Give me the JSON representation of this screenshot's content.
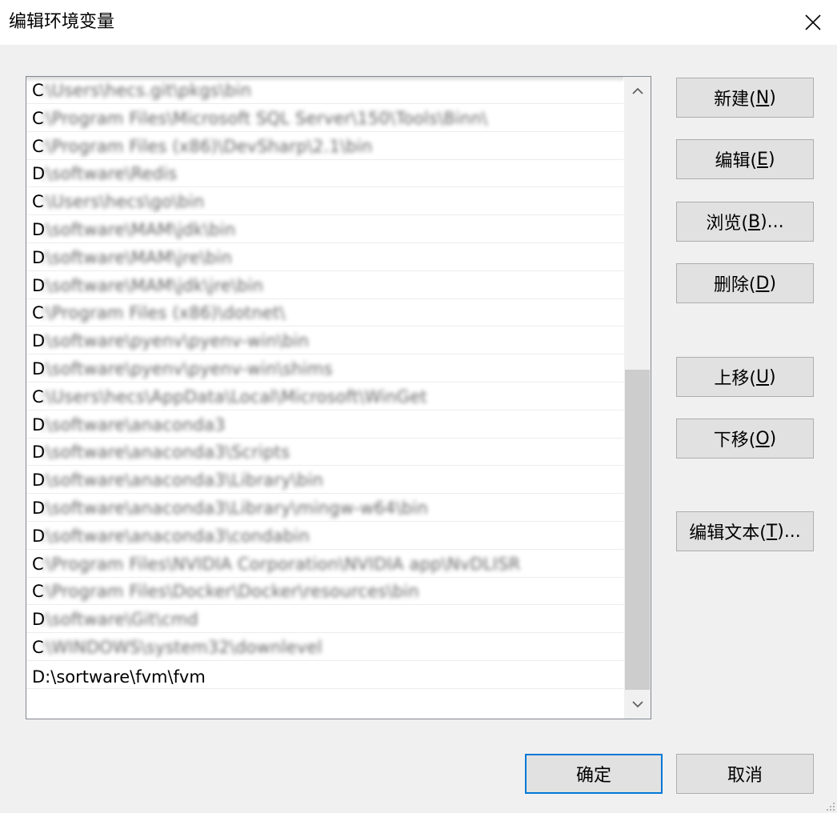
{
  "window": {
    "title": "编辑环境变量"
  },
  "icons": {
    "close": "close-icon",
    "scroll_up": "chevron-up-icon",
    "scroll_down": "chevron-down-icon",
    "size_grip": "size-grip-icon"
  },
  "path_list": {
    "items": [
      {
        "lead": "C",
        "text": ":\\Users\\hecs.git\\pkgs\\bin"
      },
      {
        "lead": "C",
        "text": ":\\Program Files\\Microsoft SQL Server\\150\\Tools\\Binn\\"
      },
      {
        "lead": "C",
        "text": ":\\Program Files (x86)\\DevSharp\\2.1\\bin"
      },
      {
        "lead": "D",
        "text": ":\\software\\Redis"
      },
      {
        "lead": "C",
        "text": ":\\Users\\hecs\\go\\bin"
      },
      {
        "lead": "D",
        "text": ":\\software\\MAM\\jdk\\bin"
      },
      {
        "lead": "D",
        "text": ":\\software\\MAM\\jre\\bin"
      },
      {
        "lead": "D",
        "text": ":\\software\\MAM\\jdk\\jre\\bin"
      },
      {
        "lead": "C",
        "text": ":\\Program Files (x86)\\dotnet\\"
      },
      {
        "lead": "D",
        "text": ":\\software\\pyenv\\pyenv-win\\bin"
      },
      {
        "lead": "D",
        "text": ":\\software\\pyenv\\pyenv-win\\shims"
      },
      {
        "lead": "C",
        "text": ":\\Users\\hecs\\AppData\\Local\\Microsoft\\WinGet"
      },
      {
        "lead": "D",
        "text": ":\\software\\anaconda3"
      },
      {
        "lead": "D",
        "text": ":\\software\\anaconda3\\Scripts"
      },
      {
        "lead": "D",
        "text": ":\\software\\anaconda3\\Library\\bin"
      },
      {
        "lead": "D",
        "text": ":\\software\\anaconda3\\Library\\mingw-w64\\bin"
      },
      {
        "lead": "D",
        "text": ":\\software\\anaconda3\\condabin"
      },
      {
        "lead": "C",
        "text": ":\\Program Files\\NVIDIA Corporation\\NVIDIA app\\NvDLISR"
      },
      {
        "lead": "C",
        "text": ":\\Program Files\\Docker\\Docker\\resources\\bin"
      },
      {
        "lead": "D",
        "text": ":\\software\\Git\\cmd"
      },
      {
        "lead": "C",
        "text": ":\\WINDOWS\\system32\\downlevel"
      }
    ],
    "selected_item": "D:\\sortware\\fvm\\fvm"
  },
  "buttons": {
    "new": {
      "label": "新建(",
      "key": "N",
      "suffix": ")"
    },
    "edit": {
      "label": "编辑(",
      "key": "E",
      "suffix": ")"
    },
    "browse": {
      "label": "浏览(",
      "key": "B",
      "suffix": ")..."
    },
    "delete": {
      "label": "删除(",
      "key": "D",
      "suffix": ")"
    },
    "move_up": {
      "label": "上移(",
      "key": "U",
      "suffix": ")"
    },
    "move_down": {
      "label": "下移(",
      "key": "O",
      "suffix": ")"
    },
    "edit_text": {
      "label": "编辑文本(",
      "key": "T",
      "suffix": ")..."
    },
    "ok": "确定",
    "cancel": "取消"
  },
  "colors": {
    "accent": "#0078d7",
    "dialog_bg": "#f0f0f0",
    "button_bg": "#e1e1e1",
    "scroll_thumb": "#cdcdcd"
  }
}
